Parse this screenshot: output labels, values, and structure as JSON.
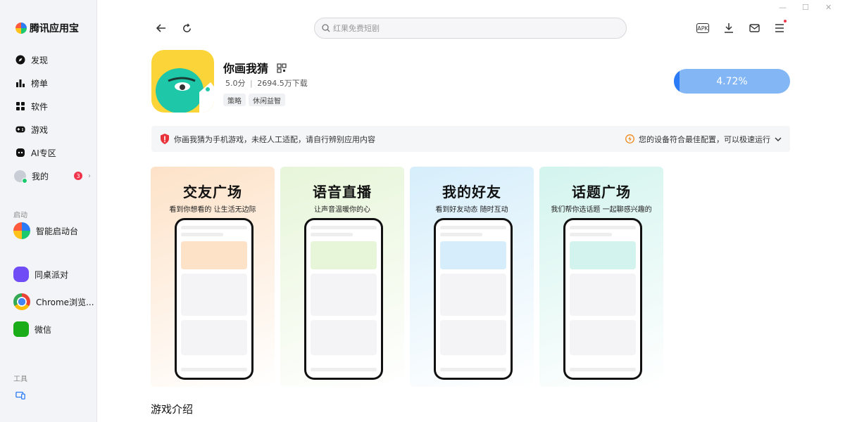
{
  "brand": {
    "name": "腾讯应用宝"
  },
  "sidebar": {
    "nav": [
      {
        "label": "发现",
        "icon": "compass-icon"
      },
      {
        "label": "榜单",
        "icon": "bar-chart-icon"
      },
      {
        "label": "软件",
        "icon": "grid-icon"
      },
      {
        "label": "游戏",
        "icon": "gamepad-icon"
      },
      {
        "label": "AI专区",
        "icon": "ai-icon"
      },
      {
        "label": "我的",
        "icon": "avatar-icon",
        "badge": "3"
      }
    ],
    "launch_label": "启动",
    "launch_item": "智能启动台",
    "apps": [
      "同桌派对",
      "Chrome浏览...",
      "微信"
    ],
    "tools_label": "工具"
  },
  "search": {
    "placeholder": "红果免费短剧"
  },
  "topbar": {
    "apk_label": "APK"
  },
  "app": {
    "name": "你画我猜",
    "rating": "5.0分",
    "downloads": "2694.5万下载",
    "separator": "|",
    "tags": [
      "策略",
      "休闲益智"
    ],
    "progress_text": "4.72%",
    "progress_value": 0.0472
  },
  "notice": {
    "left": "你画我猜为手机游戏，未经人工适配，请自行辨别应用内容",
    "right": "您的设备符合最佳配置，可以极速运行"
  },
  "screenshots": [
    {
      "title": "交友广场",
      "subtitle": "看到你想看的 让生活无边际",
      "bg": "#fde2c8"
    },
    {
      "title": "语音直播",
      "subtitle": "让声音温暖你的心",
      "bg": "#e7f5d9"
    },
    {
      "title": "我的好友",
      "subtitle": "看到好友动态 随时互动",
      "bg": "#d6eefb"
    },
    {
      "title": "话题广场",
      "subtitle": "我们帮你选话题 一起聊感兴趣的",
      "bg": "#d3f4ee"
    }
  ],
  "section": {
    "title": "游戏介绍"
  },
  "colors": {
    "accent": "#2b7bf6",
    "icon_yellow": "#fbd439",
    "icon_teal": "#1ec7a7",
    "badge": "#f0344b"
  }
}
